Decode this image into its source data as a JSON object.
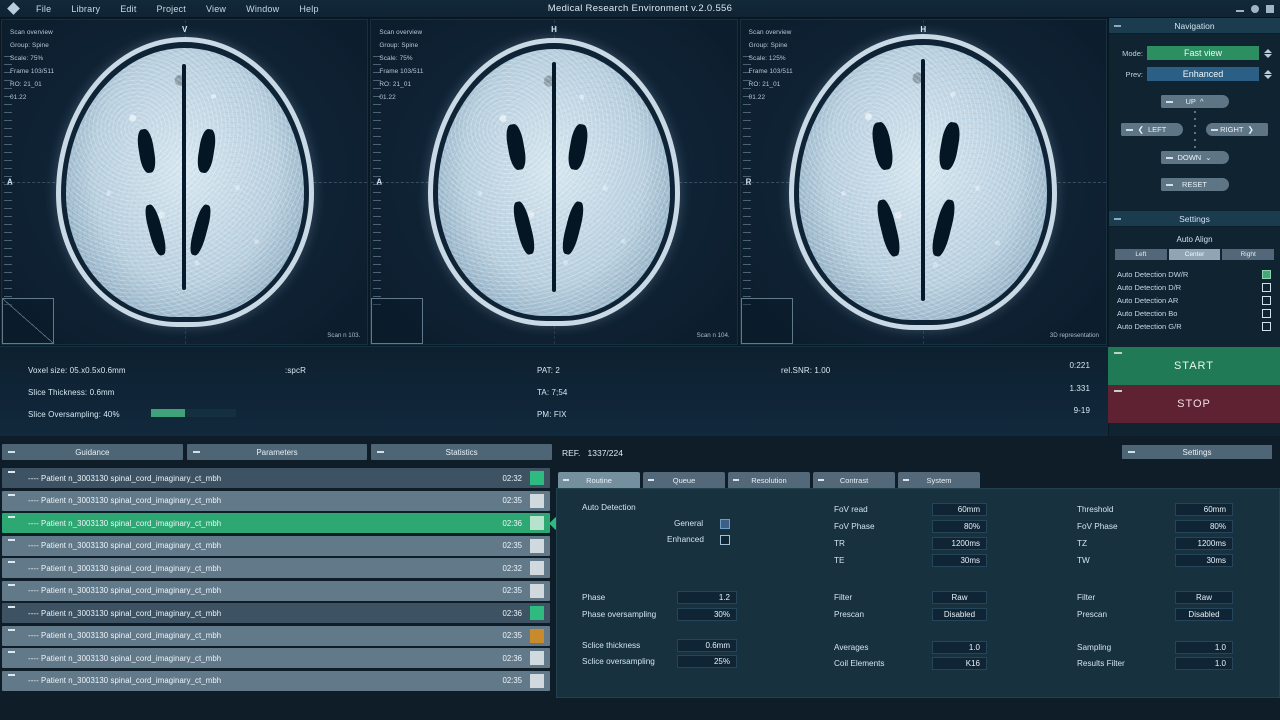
{
  "titlebar": {
    "app_title": "Medical Research Environment v.2.0.556",
    "menu": [
      "File",
      "Library",
      "Edit",
      "Project",
      "View",
      "Window",
      "Help"
    ]
  },
  "viewports": [
    {
      "meta": [
        "Scan overview",
        "Group: Spine",
        "Scale:  75%",
        "Frame 103/511",
        "RO: 21_01",
        "01.22"
      ],
      "letter_top": "V",
      "letter_left": "A",
      "corner": "Scan n 103."
    },
    {
      "meta": [
        "Scan overview",
        "Group: Spine",
        "Scale:  75%",
        "Frame 103/511",
        "RO: 21_01",
        "01.22"
      ],
      "letter_top": "H",
      "letter_left": "A",
      "corner": "Scan n 104."
    },
    {
      "meta": [
        "Scan overview",
        "Group: Spine",
        "Scale:  125%",
        "Frame 103/511",
        "RO: 21_01",
        "01.22"
      ],
      "letter_top": "H",
      "letter_left": "R",
      "corner": "3D representation"
    }
  ],
  "navigation": {
    "title": "Navigation",
    "mode_label": "Mode:",
    "mode_value": "Fast view",
    "prev_label": "Prev:",
    "prev_value": "Enhanced",
    "up": "UP",
    "down": "DOWN",
    "left": "LEFT",
    "right": "RIGHT",
    "reset": "RESET"
  },
  "settings_panel": {
    "title": "Settings",
    "auto_align": "Auto Align",
    "align_options": [
      "Left",
      "Center",
      "Right"
    ],
    "align_selected": "Center",
    "detections": [
      {
        "label": "Auto Detection DW/R",
        "checked": true
      },
      {
        "label": "Auto Detection D/R",
        "checked": false
      },
      {
        "label": "Auto Detection AR",
        "checked": false
      },
      {
        "label": "Auto Detection Bo",
        "checked": false
      },
      {
        "label": "Auto Detection G/R",
        "checked": false
      }
    ],
    "start": "START",
    "stop": "STOP"
  },
  "stats": {
    "voxel_size": "Voxel size: 05.x0.5x0.6mm",
    "slice_thickness": "Slice Thickness: 0.6mm",
    "slice_oversampling": "Slice Oversampling: 40%",
    "oversampling_pct": 40,
    "spcr": ":spcR",
    "pat": "PAT: 2",
    "ta": "TA: 7;54",
    "pm": "PM: FIX",
    "rel_snr": "rel.SNR: 1.00",
    "right_values": [
      "0:221",
      "1.331",
      "9-19"
    ]
  },
  "bottom_tabs": [
    "Guidance",
    "Parameters",
    "Statistics"
  ],
  "patient_list": [
    {
      "label": "---- Patient n_3003130 spinal_cord_imaginary_ct_mbh",
      "time": "02:32",
      "chip": "green",
      "row": "dark",
      "selected": false
    },
    {
      "label": "---- Patient n_3003130 spinal_cord_imaginary_ct_mbh",
      "time": "02:35",
      "chip": "light",
      "row": "light",
      "selected": false
    },
    {
      "label": "---- Patient n_3003130 spinal_cord_imaginary_ct_mbh",
      "time": "02:36",
      "chip": "lightgreen",
      "row": "selected",
      "selected": true
    },
    {
      "label": "---- Patient n_3003130 spinal_cord_imaginary_ct_mbh",
      "time": "02:35",
      "chip": "light",
      "row": "light",
      "selected": false
    },
    {
      "label": "---- Patient n_3003130 spinal_cord_imaginary_ct_mbh",
      "time": "02:32",
      "chip": "light",
      "row": "light",
      "selected": false
    },
    {
      "label": "---- Patient n_3003130 spinal_cord_imaginary_ct_mbh",
      "time": "02:35",
      "chip": "light",
      "row": "light",
      "selected": false
    },
    {
      "label": "---- Patient n_3003130 spinal_cord_imaginary_ct_mbh",
      "time": "02:36",
      "chip": "green",
      "row": "dark",
      "selected": false
    },
    {
      "label": "---- Patient n_3003130 spinal_cord_imaginary_ct_mbh",
      "time": "02:35",
      "chip": "orange",
      "row": "light",
      "selected": false
    },
    {
      "label": "---- Patient n_3003130 spinal_cord_imaginary_ct_mbh",
      "time": "02:36",
      "chip": "light",
      "row": "light",
      "selected": false
    },
    {
      "label": "---- Patient n_3003130 spinal_cord_imaginary_ct_mbh",
      "time": "02:35",
      "chip": "light",
      "row": "light",
      "selected": false
    }
  ],
  "ref": {
    "label": "REF.",
    "value": "1337/224",
    "settings_tab": "Settings"
  },
  "param_tabs": [
    {
      "label": "Routine",
      "active": true
    },
    {
      "label": "Queue",
      "active": false
    },
    {
      "label": "Resolution",
      "active": false
    },
    {
      "label": "Contrast",
      "active": false
    },
    {
      "label": "System",
      "active": false
    }
  ],
  "params": {
    "auto_detection_title": "Auto Detection",
    "general_label": "General",
    "general_checked": true,
    "enhanced_label": "Enhanced",
    "enhanced_checked": false,
    "col1": [
      {
        "label": "Phase",
        "value": "1.2"
      },
      {
        "label": "Phase oversampling",
        "value": "30%"
      },
      {
        "label": "Sclice thickness",
        "value": "0.6mm"
      },
      {
        "label": "Sclice oversampling",
        "value": "25%"
      }
    ],
    "col2": [
      {
        "label": "FoV read",
        "value": "60mm"
      },
      {
        "label": "FoV Phase",
        "value": "80%"
      },
      {
        "label": "TR",
        "value": "1200ms"
      },
      {
        "label": "TE",
        "value": "30ms"
      },
      {
        "label": "Filter",
        "value": "Raw"
      },
      {
        "label": "Prescan",
        "value": "Disabled"
      },
      {
        "label": "Averages",
        "value": "1.0"
      },
      {
        "label": "Coil Elements",
        "value": "K16"
      }
    ],
    "col3": [
      {
        "label": "Threshold",
        "value": "60mm"
      },
      {
        "label": "FoV Phase",
        "value": "80%"
      },
      {
        "label": "TZ",
        "value": "1200ms"
      },
      {
        "label": "TW",
        "value": "30ms"
      },
      {
        "label": "Filter",
        "value": "Raw"
      },
      {
        "label": "Prescan",
        "value": "Disabled"
      },
      {
        "label": "Sampling",
        "value": "1.0"
      },
      {
        "label": "Results Filter",
        "value": "1.0"
      }
    ]
  },
  "colors": {
    "accent_green": "#2ea873",
    "accent_blue": "#2b5f86",
    "stop_red": "#5e2232",
    "panel_bg": "#0f2331"
  }
}
